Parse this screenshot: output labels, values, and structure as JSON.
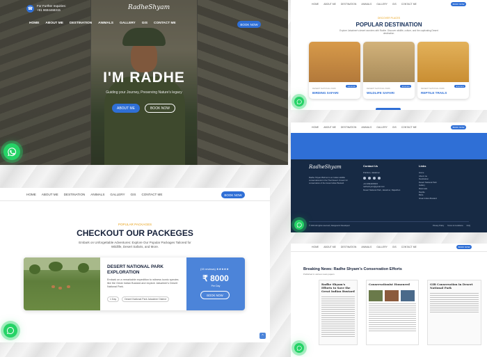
{
  "common": {
    "nav": [
      "HOME",
      "ABOUT ME",
      "DESTINATION",
      "ANIMALS",
      "GALLERY",
      "GIS",
      "CONTACT ME"
    ],
    "book_now": "BOOK NOW"
  },
  "hero": {
    "top_info_line1": "For Further Inquiries:",
    "top_info_line2": "+91 9694468315",
    "logo": "RadheShyam",
    "title": "I'M RADHE",
    "subtitle": "Guiding your Journey, Preserving Nature's legacy",
    "about_button": "ABOUT ME",
    "book_button": "BOOK NOW"
  },
  "destination": {
    "kicker": "DISCOVER PLACES",
    "title": "POPULAR DESTINATION",
    "desc": "Explore Jaisalmer's desert wonders with Radhe. Discover wildlife, culture, and the captivating Desert destination.",
    "cards": [
      {
        "tag": "DESERT NATIONAL PARK",
        "stars": "★★★★★",
        "name": "BIRDING SAFARI",
        "color_top": "#d79a4a",
        "color_bottom": "#b3793a"
      },
      {
        "tag": "DESERT NATIONAL PARK",
        "stars": "★★★★★",
        "name": "WILDLIFE SAFARI",
        "color_top": "#d2b27a",
        "color_bottom": "#a98c5b"
      },
      {
        "tag": "DESERT NATIONAL PARK",
        "stars": "★★★★★",
        "name": "REPTILE TRAILS",
        "color_top": "#e3b15a",
        "color_bottom": "#c98e33"
      }
    ]
  },
  "footer": {
    "logo": "RadheShyam",
    "desc": "Radhe Shyam Bishnoi is an Indian wildlife conservationist in the Thar Desert. Known for conservation of the Great Indian Bustard.",
    "contact_title": "Contact Us",
    "contact_lines": [
      "Pokhran, Jaisalmer",
      "+91 9694468315",
      "radheshyam@gmail.com",
      "Desert National Park, Jaisalmer, Rajasthan"
    ],
    "links_title": "Links",
    "links": [
      "Home",
      "About me",
      "Destination",
      "Desert National Park",
      "Gallery",
      "Mammals",
      "Reptile",
      "Birds",
      "Great Indian Bustard"
    ],
    "copyright": "© 2024 All rights reserved | Designed & Developed",
    "policies": [
      "Privacy Policy",
      "Terms & Conditions",
      "FAQ"
    ]
  },
  "packages": {
    "kicker": "POPULAR PACKAGES",
    "title": "CHECKOUT OUR PACKEGES",
    "desc": "Embark on Unforgettable Adventures: Explore Our Popular Packages Tailored for Wildlife, Desert Safaris, and More.",
    "item": {
      "name": "DESERT NATIONAL PARK EXPLORATION",
      "desc": "Embark on a remarkable expedition to witness iconic species like the Great Indian Bustard and explore Jaisalmer's Desert National Park.",
      "duration": "1 Day",
      "location": "Desert National Park Jaisalmer District",
      "reviews": "(15 reviews) ★★★★★",
      "price": "₹ 8000",
      "per": "Per Day",
      "book": "BOOK NOW"
    }
  },
  "news": {
    "title": "Breaking News: Radhe Shyam's Conservation Efforts",
    "byline": "Published in various news papers",
    "clips": [
      {
        "headline": "Radhe Shyam's Efforts to Save the Great Indian Bustard"
      },
      {
        "headline": "Conservationist Honoured"
      },
      {
        "headline": "GIB Conservation in Desert National Park"
      }
    ]
  }
}
